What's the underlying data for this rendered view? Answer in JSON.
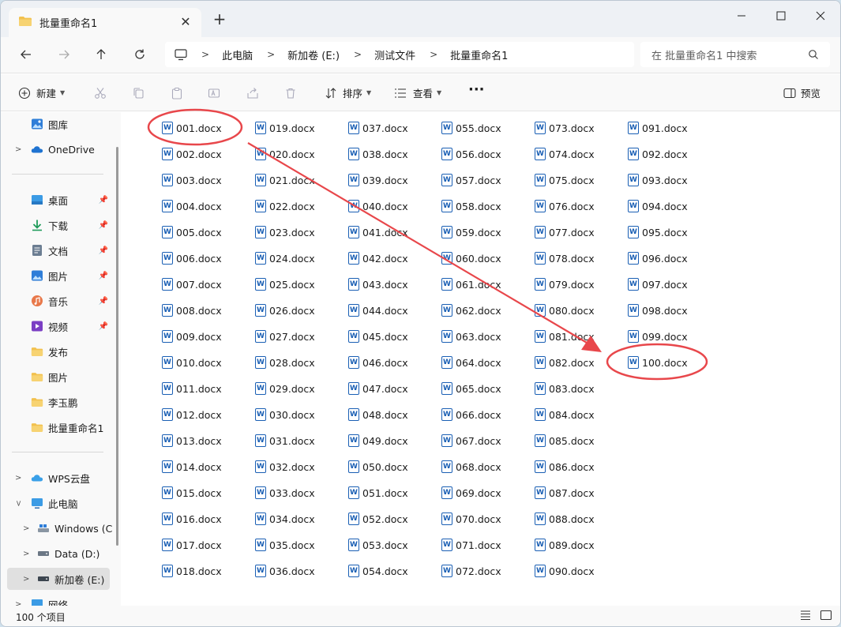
{
  "window": {
    "tab_title": "批量重命名1",
    "tab_close": "✕",
    "tab_add": "+"
  },
  "breadcrumb": [
    "此电脑",
    "新加卷 (E:)",
    "测试文件",
    "批量重命名1"
  ],
  "search": {
    "placeholder": "在 批量重命名1 中搜索"
  },
  "toolbar": {
    "new_label": "新建",
    "sort_label": "排序",
    "view_label": "查看",
    "more_label": "···",
    "preview_label": "预览"
  },
  "sidebar": {
    "items": [
      {
        "label": "图库",
        "icon": "gallery-icon"
      },
      {
        "label": "OneDrive",
        "icon": "onedrive-icon"
      },
      {
        "label": "桌面",
        "icon": "desktop-icon"
      },
      {
        "label": "下载",
        "icon": "download-icon"
      },
      {
        "label": "文档",
        "icon": "documents-icon"
      },
      {
        "label": "图片",
        "icon": "pictures-icon"
      },
      {
        "label": "音乐",
        "icon": "music-icon"
      },
      {
        "label": "视频",
        "icon": "videos-icon"
      },
      {
        "label": "发布",
        "icon": "folder-icon"
      },
      {
        "label": "图片",
        "icon": "folder-icon"
      },
      {
        "label": "李玉鹏",
        "icon": "folder-icon"
      },
      {
        "label": "批量重命名1",
        "icon": "folder-icon"
      },
      {
        "label": "WPS云盘",
        "icon": "wps-cloud-icon"
      },
      {
        "label": "此电脑",
        "icon": "this-pc-icon"
      },
      {
        "label": "Windows (C",
        "icon": "windows-drive-icon"
      },
      {
        "label": "Data (D:)",
        "icon": "drive-icon"
      },
      {
        "label": "新加卷 (E:)",
        "icon": "drive-icon"
      },
      {
        "label": "网络",
        "icon": "network-icon"
      }
    ]
  },
  "files": [
    "001.docx",
    "002.docx",
    "003.docx",
    "004.docx",
    "005.docx",
    "006.docx",
    "007.docx",
    "008.docx",
    "009.docx",
    "010.docx",
    "011.docx",
    "012.docx",
    "013.docx",
    "014.docx",
    "015.docx",
    "016.docx",
    "017.docx",
    "018.docx",
    "019.docx",
    "020.docx",
    "021.docx",
    "022.docx",
    "023.docx",
    "024.docx",
    "025.docx",
    "026.docx",
    "027.docx",
    "028.docx",
    "029.docx",
    "030.docx",
    "031.docx",
    "032.docx",
    "033.docx",
    "034.docx",
    "035.docx",
    "036.docx",
    "037.docx",
    "038.docx",
    "039.docx",
    "040.docx",
    "041.docx",
    "042.docx",
    "043.docx",
    "044.docx",
    "045.docx",
    "046.docx",
    "047.docx",
    "048.docx",
    "049.docx",
    "050.docx",
    "051.docx",
    "052.docx",
    "053.docx",
    "054.docx",
    "055.docx",
    "056.docx",
    "057.docx",
    "058.docx",
    "059.docx",
    "060.docx",
    "061.docx",
    "062.docx",
    "063.docx",
    "064.docx",
    "065.docx",
    "066.docx",
    "067.docx",
    "068.docx",
    "069.docx",
    "070.docx",
    "071.docx",
    "072.docx",
    "073.docx",
    "074.docx",
    "075.docx",
    "076.docx",
    "077.docx",
    "078.docx",
    "079.docx",
    "080.docx",
    "081.docx",
    "082.docx",
    "083.docx",
    "084.docx",
    "085.docx",
    "086.docx",
    "087.docx",
    "088.docx",
    "089.docx",
    "090.docx",
    "091.docx",
    "092.docx",
    "093.docx",
    "094.docx",
    "095.docx",
    "096.docx",
    "097.docx",
    "098.docx",
    "099.docx",
    "100.docx"
  ],
  "file_icon_letter": "W",
  "status": {
    "item_count": "100 个项目"
  },
  "colors": {
    "annotation": "#e8474b",
    "word_blue": "#1a5fb4",
    "folder": "#f2c14e"
  }
}
